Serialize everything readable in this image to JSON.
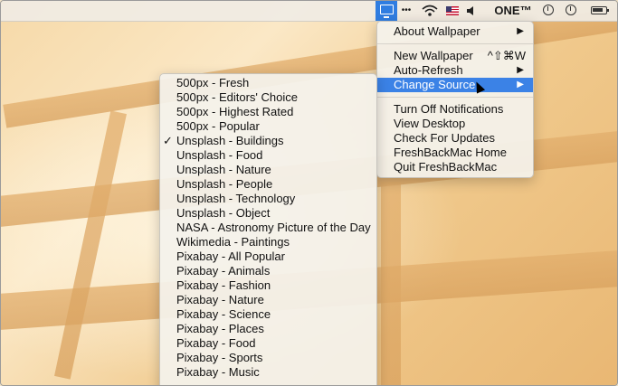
{
  "menubar": {
    "dots": "•••",
    "app_label": "ONE™"
  },
  "main_menu": {
    "items": [
      {
        "label": "About Wallpaper",
        "arrow": "▶"
      },
      {
        "label": "New Wallpaper",
        "shortcut": "^⇧⌘W"
      },
      {
        "label": "Auto-Refresh",
        "arrow": "▶"
      },
      {
        "label": "Change Source",
        "arrow": "▶"
      },
      {
        "label": "Turn Off Notifications"
      },
      {
        "label": "View Desktop"
      },
      {
        "label": "Check For Updates"
      },
      {
        "label": "FreshBackMac Home"
      },
      {
        "label": "Quit FreshBackMac"
      }
    ]
  },
  "source_menu": {
    "check_mark": "✓",
    "items": [
      "500px - Fresh",
      "500px - Editors' Choice",
      "500px - Highest Rated",
      "500px - Popular",
      "Unsplash - Buildings",
      "Unsplash - Food",
      "Unsplash - Nature",
      "Unsplash - People",
      "Unsplash - Technology",
      "Unsplash - Object",
      "NASA - Astronomy Picture of the Day",
      "Wikimedia - Paintings",
      "Pixabay - All Popular",
      "Pixabay - Animals",
      "Pixabay - Fashion",
      "Pixabay - Nature",
      "Pixabay - Science",
      "Pixabay - Places",
      "Pixabay - Food",
      "Pixabay - Sports",
      "Pixabay - Music"
    ]
  }
}
